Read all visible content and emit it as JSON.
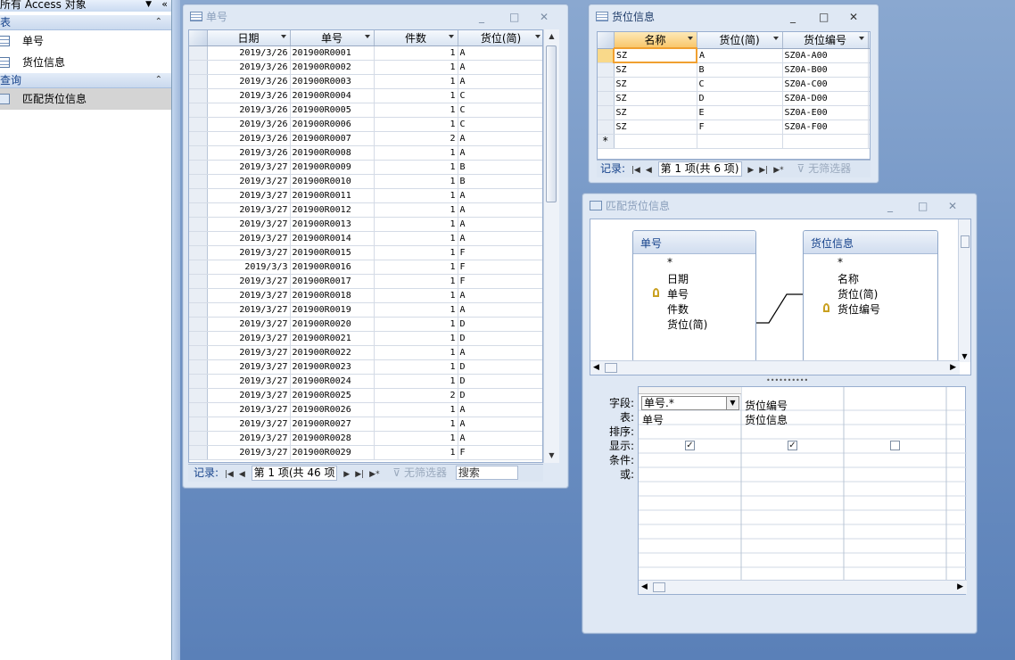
{
  "nav": {
    "title": "所有 Access 对象",
    "group_tables": "表",
    "tables": [
      "单号",
      "货位信息"
    ],
    "group_queries": "查询",
    "queries": [
      "匹配货位信息"
    ]
  },
  "win1": {
    "title": "单号",
    "columns": [
      "日期",
      "单号",
      "件数",
      "货位(简)"
    ],
    "rows": [
      [
        "2019/3/26",
        "201900R0001",
        "1",
        "A"
      ],
      [
        "2019/3/26",
        "201900R0002",
        "1",
        "A"
      ],
      [
        "2019/3/26",
        "201900R0003",
        "1",
        "A"
      ],
      [
        "2019/3/26",
        "201900R0004",
        "1",
        "C"
      ],
      [
        "2019/3/26",
        "201900R0005",
        "1",
        "C"
      ],
      [
        "2019/3/26",
        "201900R0006",
        "1",
        "C"
      ],
      [
        "2019/3/26",
        "201900R0007",
        "2",
        "A"
      ],
      [
        "2019/3/26",
        "201900R0008",
        "1",
        "A"
      ],
      [
        "2019/3/27",
        "201900R0009",
        "1",
        "B"
      ],
      [
        "2019/3/27",
        "201900R0010",
        "1",
        "B"
      ],
      [
        "2019/3/27",
        "201900R0011",
        "1",
        "A"
      ],
      [
        "2019/3/27",
        "201900R0012",
        "1",
        "A"
      ],
      [
        "2019/3/27",
        "201900R0013",
        "1",
        "A"
      ],
      [
        "2019/3/27",
        "201900R0014",
        "1",
        "A"
      ],
      [
        "2019/3/27",
        "201900R0015",
        "1",
        "F"
      ],
      [
        "2019/3/3",
        "201900R0016",
        "1",
        "F"
      ],
      [
        "2019/3/27",
        "201900R0017",
        "1",
        "F"
      ],
      [
        "2019/3/27",
        "201900R0018",
        "1",
        "A"
      ],
      [
        "2019/3/27",
        "201900R0019",
        "1",
        "A"
      ],
      [
        "2019/3/27",
        "201900R0020",
        "1",
        "D"
      ],
      [
        "2019/3/27",
        "201900R0021",
        "1",
        "D"
      ],
      [
        "2019/3/27",
        "201900R0022",
        "1",
        "A"
      ],
      [
        "2019/3/27",
        "201900R0023",
        "1",
        "D"
      ],
      [
        "2019/3/27",
        "201900R0024",
        "1",
        "D"
      ],
      [
        "2019/3/27",
        "201900R0025",
        "2",
        "D"
      ],
      [
        "2019/3/27",
        "201900R0026",
        "1",
        "A"
      ],
      [
        "2019/3/27",
        "201900R0027",
        "1",
        "A"
      ],
      [
        "2019/3/27",
        "201900R0028",
        "1",
        "A"
      ],
      [
        "2019/3/27",
        "201900R0029",
        "1",
        "F"
      ]
    ],
    "rec_label": "记录:",
    "rec_box": "第 1 项(共 46 项",
    "nofilter": "无筛选器",
    "search": "搜索"
  },
  "win2": {
    "title": "货位信息",
    "columns": [
      "名称",
      "货位(简)",
      "货位编号"
    ],
    "rows": [
      [
        "SZ",
        "A",
        "SZ0A-A00"
      ],
      [
        "SZ",
        "B",
        "SZ0A-B00"
      ],
      [
        "SZ",
        "C",
        "SZ0A-C00"
      ],
      [
        "SZ",
        "D",
        "SZ0A-D00"
      ],
      [
        "SZ",
        "E",
        "SZ0A-E00"
      ],
      [
        "SZ",
        "F",
        "SZ0A-F00"
      ]
    ],
    "new_row": "*",
    "rec_label": "记录:",
    "rec_box": "第 1 项(共 6 项)",
    "nofilter": "无筛选器"
  },
  "win3": {
    "title": "匹配货位信息",
    "t1": {
      "title": "单号",
      "fields": [
        "*",
        "日期",
        "单号",
        "件数",
        "货位(简)"
      ]
    },
    "t2": {
      "title": "货位信息",
      "fields": [
        "*",
        "名称",
        "货位(简)",
        "货位编号"
      ]
    },
    "row_labels": [
      "字段:",
      "表:",
      "排序:",
      "显示:",
      "条件:",
      "或:"
    ],
    "col1": {
      "field": "单号.*",
      "table": "单号"
    },
    "col2": {
      "field": "货位编号",
      "table": "货位信息"
    }
  }
}
